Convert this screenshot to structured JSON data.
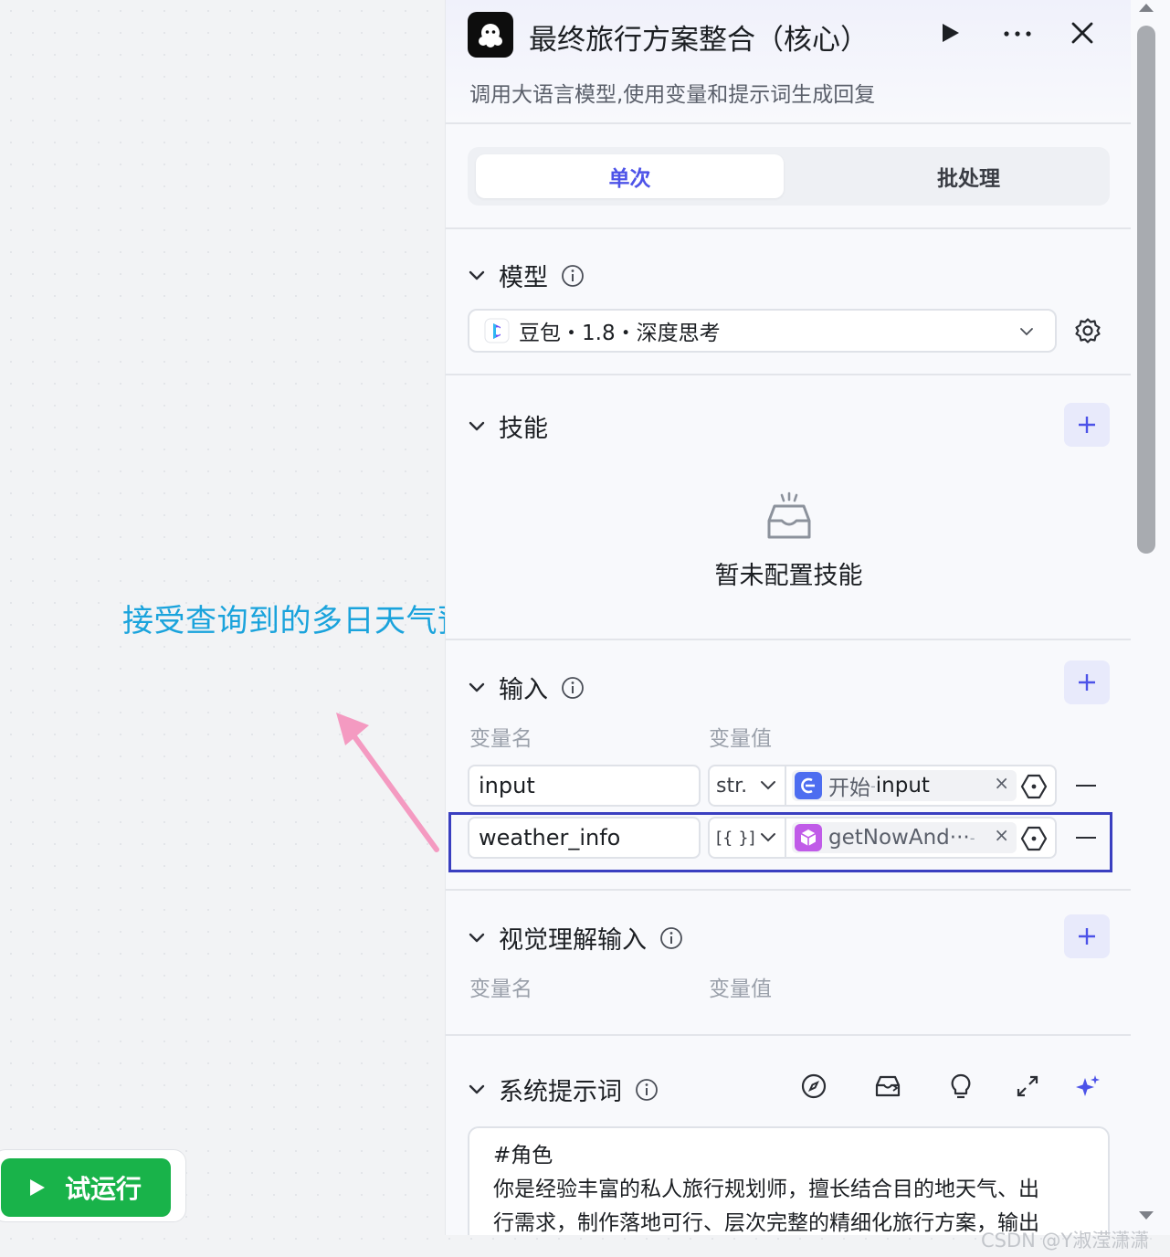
{
  "annotation": {
    "text": "接受查询到的多日天气预报"
  },
  "run_button": {
    "label": "试运行"
  },
  "node": {
    "title": "最终旅行方案整合（核心）",
    "description": "调用大语言模型,使用变量和提示词生成回复"
  },
  "tabs": {
    "single": "单次",
    "batch": "批处理"
  },
  "model_section": {
    "title": "模型",
    "selected": "豆包・1.8・深度思考"
  },
  "skills_section": {
    "title": "技能",
    "empty_text": "暂未配置技能"
  },
  "input_section": {
    "title": "输入",
    "col_name": "变量名",
    "col_value": "变量值",
    "rows": [
      {
        "name": "input",
        "type": "str.",
        "ref_node": "开始",
        "ref_sep": " - ",
        "ref_var": "input"
      },
      {
        "name": "weather_info",
        "type": "[{ }]",
        "ref_node": "getNowAnd···",
        "ref_sep": " - ",
        "ref_var": ""
      }
    ]
  },
  "vision_section": {
    "title": "视觉理解输入",
    "col_name": "变量名",
    "col_value": "变量值"
  },
  "system_prompt": {
    "title": "系统提示词",
    "lines": [
      "#角色",
      "你是经验丰富的私人旅行规划师，擅长结合目的地天气、出",
      "行需求，制作落地可行、层次完整的精细化旅行方案，输出"
    ]
  },
  "watermark": "CSDN @Y淑滢潇潇",
  "colors": {
    "accent": "#4d53e8",
    "run_green": "#19b34a",
    "annotation": "#1aa3dc",
    "arrow": "#f49ac1"
  }
}
